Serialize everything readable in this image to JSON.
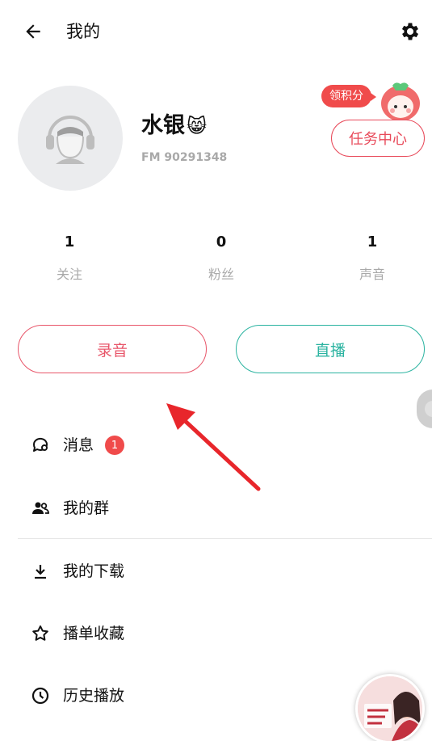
{
  "header": {
    "title": "我的",
    "back_icon": "arrow-left-icon",
    "settings_icon": "gear-icon"
  },
  "profile": {
    "avatar_icon": "default-avatar-headphones-icon",
    "name": "水银",
    "name_emoji": "😸",
    "fm_id": "FM 90291348"
  },
  "rewards": {
    "points_badge": "领积分",
    "mascot_icon": "lychee-mascot-icon",
    "task_center": "任务中心"
  },
  "stats": [
    {
      "value": "1",
      "label": "关注"
    },
    {
      "value": "0",
      "label": "粉丝"
    },
    {
      "value": "1",
      "label": "声音"
    }
  ],
  "actions": {
    "record": "录音",
    "live": "直播"
  },
  "menu": [
    {
      "label": "消息",
      "icon": "chat-bubble-icon",
      "badge": "1"
    },
    {
      "label": "我的群",
      "icon": "group-icon"
    },
    {
      "label": "我的下载",
      "icon": "download-icon"
    },
    {
      "label": "播单收藏",
      "icon": "star-icon"
    },
    {
      "label": "历史播放",
      "icon": "clock-icon"
    }
  ],
  "colors": {
    "accent_red": "#e84a5a",
    "accent_teal": "#2ab3a0",
    "badge_red": "#f04b4b",
    "muted_text": "#a9a9a9",
    "annotation_arrow": "#e8262b"
  },
  "player": {
    "thumbnail_icon": "now-playing-cover-icon"
  }
}
